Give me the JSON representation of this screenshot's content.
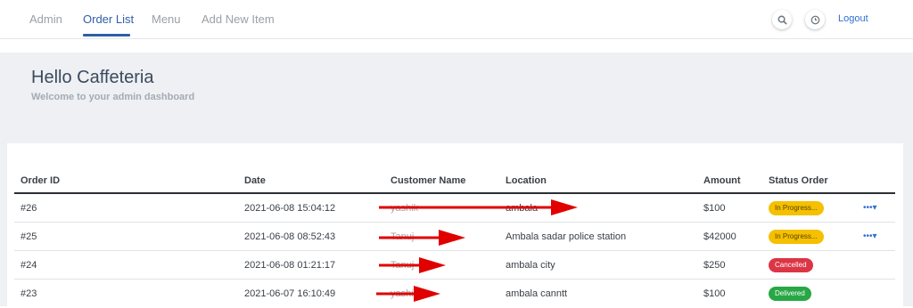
{
  "nav": {
    "items": [
      {
        "label": "Admin",
        "active": false
      },
      {
        "label": "Order List",
        "active": true
      },
      {
        "label": "Menu",
        "active": false
      },
      {
        "label": "Add New Item",
        "active": false
      }
    ],
    "search_icon": "search-icon",
    "clock_icon": "clock-icon",
    "logout_label": "Logout"
  },
  "hero": {
    "title": "Hello Caffeteria",
    "subtitle": "Welcome to your admin dashboard"
  },
  "table": {
    "headers": [
      "Order ID",
      "Date",
      "Customer Name",
      "Location",
      "Amount",
      "Status Order"
    ],
    "rows": [
      {
        "id": "#26",
        "date": "2021-06-08 15:04:12",
        "customer": "yashik",
        "location": "ambala",
        "amount": "$100",
        "status": "In Progress...",
        "status_type": "progress",
        "actions": true
      },
      {
        "id": "#25",
        "date": "2021-06-08 08:52:43",
        "customer": "Tanuj",
        "location": "Ambala sadar police station",
        "amount": "$42000",
        "status": "In Progress...",
        "status_type": "progress",
        "actions": true
      },
      {
        "id": "#24",
        "date": "2021-06-08 01:21:17",
        "customer": "Tanuj",
        "location": "ambala city",
        "amount": "$250",
        "status": "Cancelled",
        "status_type": "cancelled",
        "actions": false
      },
      {
        "id": "#23",
        "date": "2021-06-07 16:10:49",
        "customer": "yashik",
        "location": "ambala canntt",
        "amount": "$100",
        "status": "Delivered",
        "status_type": "delivered",
        "actions": false
      }
    ],
    "actions_icon": "more-dots-icon"
  },
  "colors": {
    "accent": "#2f5fa8",
    "progress": "#f5c000",
    "cancelled": "#dc3545",
    "delivered": "#28a745",
    "annotation_arrow": "#e00000"
  }
}
